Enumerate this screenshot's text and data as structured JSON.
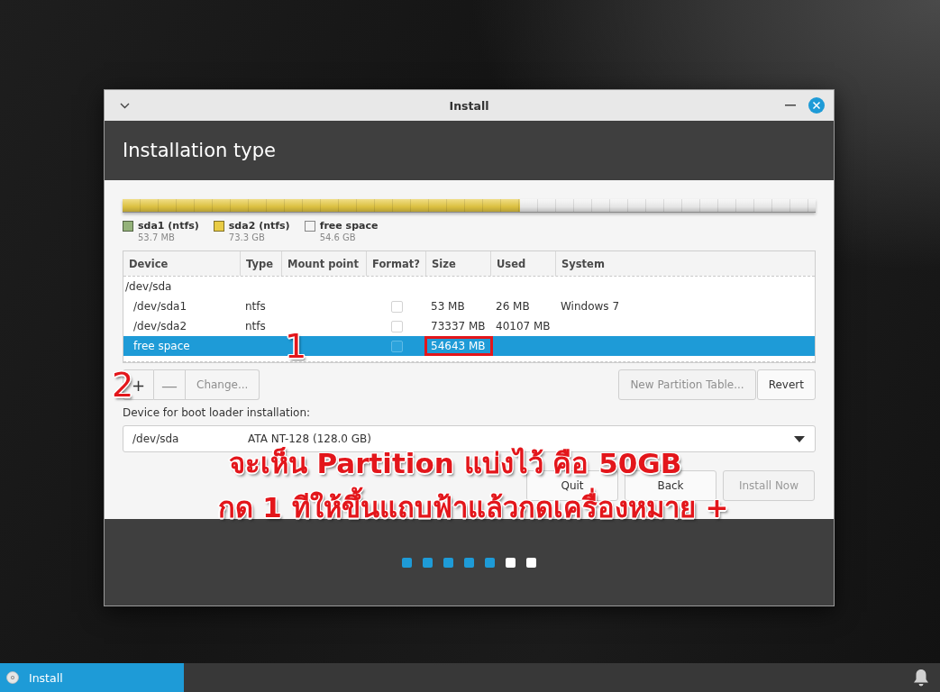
{
  "window": {
    "title": "Install",
    "heading": "Installation type"
  },
  "partition_bar": {
    "segments": [
      {
        "label": "sda1 (ntfs)",
        "size": "53.7 MB",
        "color": "#94b27a",
        "level": 0.0004
      },
      {
        "label": "sda2 (ntfs)",
        "size": "73.3 GB",
        "color": "#e9cc45",
        "level": 0.5726
      },
      {
        "label": "free space",
        "size": "54.6 GB",
        "color": "#f4f4f4",
        "level": 0.427
      }
    ]
  },
  "table": {
    "columns": [
      "Device",
      "Type",
      "Mount point",
      "Format?",
      "Size",
      "Used",
      "System"
    ],
    "rows": [
      {
        "device": "/dev/sda",
        "selected": false,
        "children": [
          {
            "device": "/dev/sda1",
            "type": "ntfs",
            "format": false,
            "size": "53 MB",
            "used": "26 MB",
            "system": "Windows 7",
            "selected": false,
            "size_boxed": false
          },
          {
            "device": "/dev/sda2",
            "type": "ntfs",
            "format": false,
            "size": "73337 MB",
            "used": "40107 MB",
            "selected": false,
            "size_boxed": false
          },
          {
            "device": "free space",
            "format": false,
            "size": "54643 MB",
            "selected": true,
            "size_boxed": true
          }
        ]
      }
    ]
  },
  "partition_tools": {
    "left": [
      {
        "label": "+",
        "disabled": false
      },
      {
        "label": "—",
        "disabled": true
      },
      {
        "label": "Change...",
        "disabled": true
      }
    ],
    "right": [
      {
        "label": "New Partition Table...",
        "disabled": true
      },
      {
        "label": "Revert",
        "disabled": false
      }
    ]
  },
  "boot_loader": {
    "label": "Device for boot loader installation:",
    "device": "/dev/sda",
    "description": "ATA NT-128 (128.0 GB)"
  },
  "actions": [
    {
      "label": "Quit",
      "disabled": false
    },
    {
      "label": "Back",
      "disabled": false
    },
    {
      "label": "Install Now",
      "disabled": true
    }
  ],
  "steps": [
    {
      "done": true
    },
    {
      "done": true
    },
    {
      "done": true
    },
    {
      "done": true
    },
    {
      "done": true
    },
    {
      "done": false
    },
    {
      "done": false
    }
  ],
  "annotations": {
    "markers": [
      "1",
      "2"
    ],
    "caption": [
      "จะเห็น Partition แบ่งไว้ คือ 50GB",
      "กด 1 ทีให้ขึ้นแถบฟ้าแล้วกดเครื่องหมาย +"
    ]
  },
  "taskbar": {
    "tasks": [
      {
        "label": "Install",
        "selected": true
      }
    ]
  }
}
